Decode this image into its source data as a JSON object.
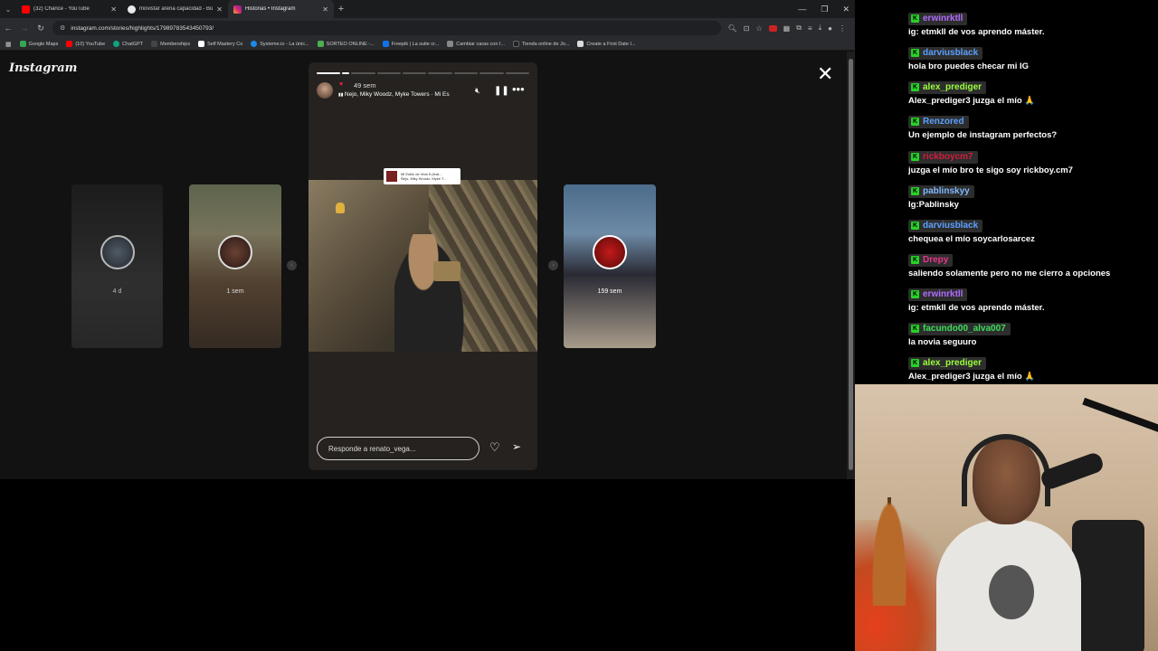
{
  "browser": {
    "tabs": [
      {
        "title": "(32) Chance - YouTube",
        "color": "#ff0000"
      },
      {
        "title": "movistar arena capacidad - Bu",
        "color": "#e8eaed"
      },
      {
        "title": "Historias • Instagram",
        "color": "#d62976",
        "active": true
      }
    ],
    "url": "instagram.com/stories/highlights/17989783543450793/",
    "bookmarks": [
      {
        "label": "Google Maps",
        "color": "#34a853"
      },
      {
        "label": "(10) YouTube",
        "color": "#ff0000"
      },
      {
        "label": "ChatGPT",
        "color": "#10a37f"
      },
      {
        "label": "Memberships",
        "color": "#444444"
      },
      {
        "label": "Self Mastery Co",
        "color": "#ffffff"
      },
      {
        "label": "Systeme.io - La únic...",
        "color": "#1e88e5"
      },
      {
        "label": "SORTEO ONLINE -...",
        "color": "#4caf50"
      },
      {
        "label": "Freepik | La suite cr...",
        "color": "#1273eb"
      },
      {
        "label": "Cambiar caras con I...",
        "color": "#888888"
      },
      {
        "label": "Tienda online de Jo...",
        "color": "#222222"
      },
      {
        "label": "Create a First Date I...",
        "color": "#dddddd"
      }
    ]
  },
  "instagram": {
    "logo": "Instagram",
    "side_stories": [
      {
        "label": "4 d"
      },
      {
        "label": "1 sem"
      },
      {
        "label": "159 sem"
      }
    ],
    "story": {
      "time": "49 sem",
      "song": "Ñejo, Miky Woodz, Myke Towers · Mi Es",
      "sticker_title": "Mi Estilo de Vida ft (feat...",
      "sticker_artists": "Ñejo, Miky Woodz, Myke T...",
      "reply_placeholder": "Responde a renato_vega..."
    }
  },
  "chat": {
    "messages": [
      {
        "user": "erwinrktll",
        "color": "#b06cff",
        "text": "ig: etmkll de vos aprendo máster."
      },
      {
        "user": "darviusblack",
        "color": "#5aa0ff",
        "text": "hola bro puedes checar mi IG"
      },
      {
        "user": "alex_prediger",
        "color": "#9bff3b",
        "text": "Alex_prediger3 juzga el mío 🙏"
      },
      {
        "user": "Renzored",
        "color": "#5aa0ff",
        "text": "Un ejemplo de instagram perfectos?"
      },
      {
        "user": "rickboycm7",
        "color": "#d21b3c",
        "text": "juzga el mío bro te sigo soy rickboy.cm7"
      },
      {
        "user": "pablinskyy",
        "color": "#7fb8ff",
        "text": "Ig:Pablinsky"
      },
      {
        "user": "darviusblack",
        "color": "#5aa0ff",
        "text": "chequea el mío soycarlosarcez"
      },
      {
        "user": "Drepy",
        "color": "#e8358a",
        "text": "saliendo solamente pero no me cierro a opciones"
      },
      {
        "user": "erwinrktll",
        "color": "#b06cff",
        "text": "ig: etmkll de vos aprendo máster."
      },
      {
        "user": "facundo00_alva007",
        "color": "#3bdc5a",
        "text": "la novia seguuro"
      },
      {
        "user": "alex_prediger",
        "color": "#9bff3b",
        "text": "Alex_prediger3 juzga el mío 🙏"
      }
    ]
  }
}
